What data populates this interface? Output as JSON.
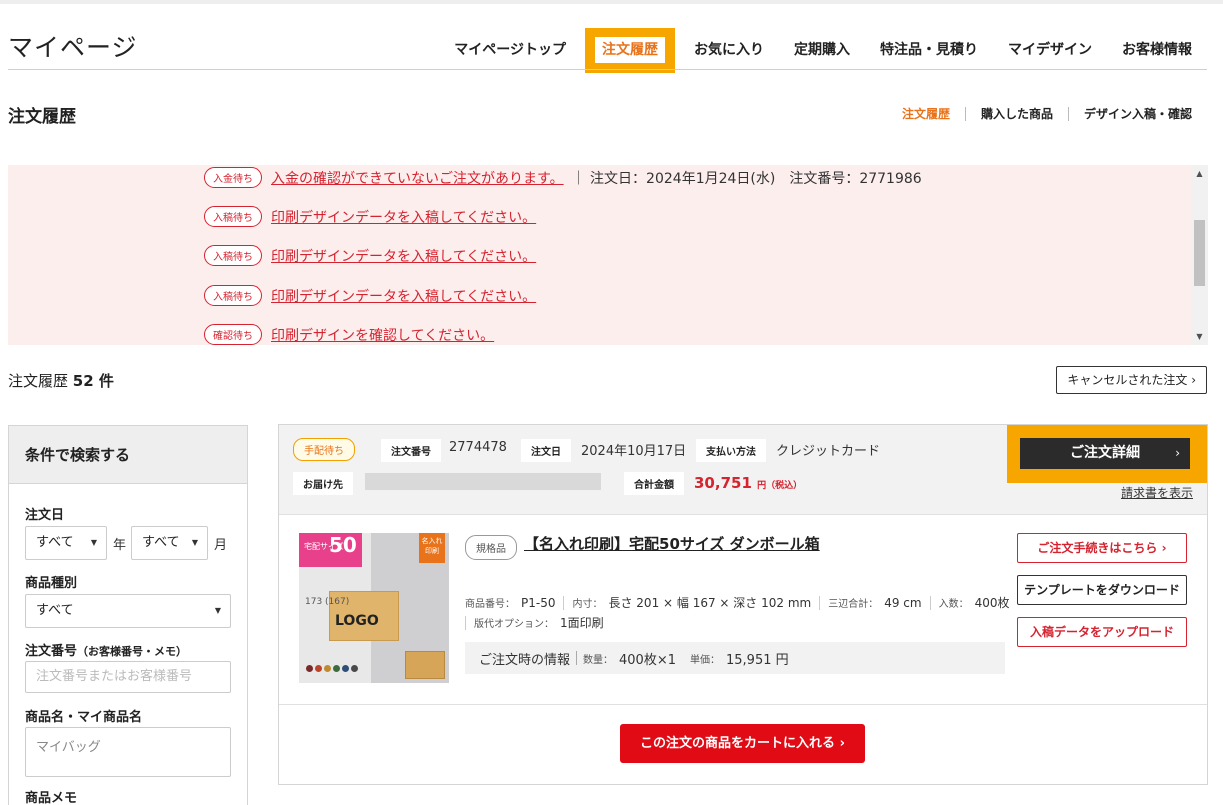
{
  "header": {
    "title": "マイページ",
    "nav": [
      "マイページトップ",
      "注文履歴",
      "お気に入り",
      "定期購入",
      "特注品・見積り",
      "マイデザイン",
      "お客様情報"
    ]
  },
  "section": {
    "title": "注文履歴",
    "subnav": [
      "注文履歴",
      "購入した商品",
      "デザイン入稿・確認"
    ]
  },
  "notices": [
    {
      "badge": "入金待ち",
      "text": "入金の確認ができていないご注文があります。",
      "meta": "｜ 注文日：2024年1月24日(水)　注文番号：2771986"
    },
    {
      "badge": "入稿待ち",
      "text": "印刷デザインデータを入稿してください。",
      "meta": ""
    },
    {
      "badge": "入稿待ち",
      "text": "印刷デザインデータを入稿してください。",
      "meta": ""
    },
    {
      "badge": "入稿待ち",
      "text": "印刷デザインデータを入稿してください。",
      "meta": ""
    },
    {
      "badge": "確認待ち",
      "text": "印刷デザインを確認してください。",
      "meta": ""
    }
  ],
  "history": {
    "label": "注文履歴",
    "count": "52 件",
    "cancelled_button": "キャンセルされた注文"
  },
  "sidebar": {
    "title": "条件で検索する",
    "order_date_label": "注文日",
    "year_value": "すべて",
    "year_unit": "年",
    "month_value": "すべて",
    "month_unit": "月",
    "category_label": "商品種別",
    "category_value": "すべて",
    "order_no_label": "注文番号",
    "order_no_note": "（お客様番号・メモ）",
    "order_no_placeholder": "注文番号またはお客様番号",
    "product_name_label": "商品名・マイ商品名",
    "product_name_value": "マイバッグ",
    "memo_label": "商品メモ"
  },
  "order": {
    "status": "手配待ち",
    "order_no_label": "注文番号",
    "order_no": "2774478",
    "date_label": "注文日",
    "date": "2024年10月17日",
    "payment_label": "支払い方法",
    "payment": "クレジットカード",
    "ship_label": "お届け先",
    "total_label": "合計金額",
    "total": "30,751",
    "total_unit": "円（税込）",
    "detail_button": "ご注文詳細",
    "invoice_link": "請求書を表示",
    "product": {
      "badge": "規格品",
      "name": "【名入れ印刷】宅配50サイズ ダンボール箱",
      "code_label": "商品番号：",
      "code": "P1-50",
      "inner_label": "内寸：",
      "inner": "長さ 201 × 幅 167 × 深さ 102 mm",
      "sum_label": "三辺合計：",
      "sum": "49 cm",
      "qty_label": "入数：",
      "qty": "400枚",
      "option_label": "版代オプション：",
      "option": "1面印刷",
      "info_title": "ご注文時の情報",
      "info_qty_label": "数量：",
      "info_qty": "400枚×1",
      "info_price_label": "単価：",
      "info_price": "15,951 円",
      "img_size": "50",
      "img_size_label": "宅配サイズ",
      "img_mark": "名入れ印刷",
      "img_logo": "LOGO",
      "img_dims": "173 (167)"
    },
    "actions": {
      "procedure": "ご注文手続きはこちら",
      "template": "テンプレートをダウンロード",
      "upload": "入稿データをアップロード"
    },
    "cart_button": "この注文の商品をカートに入れる"
  },
  "colors": {
    "accent_orange": "#f7a600",
    "alert_red": "#d5232f",
    "cart_red": "#e00b14"
  }
}
